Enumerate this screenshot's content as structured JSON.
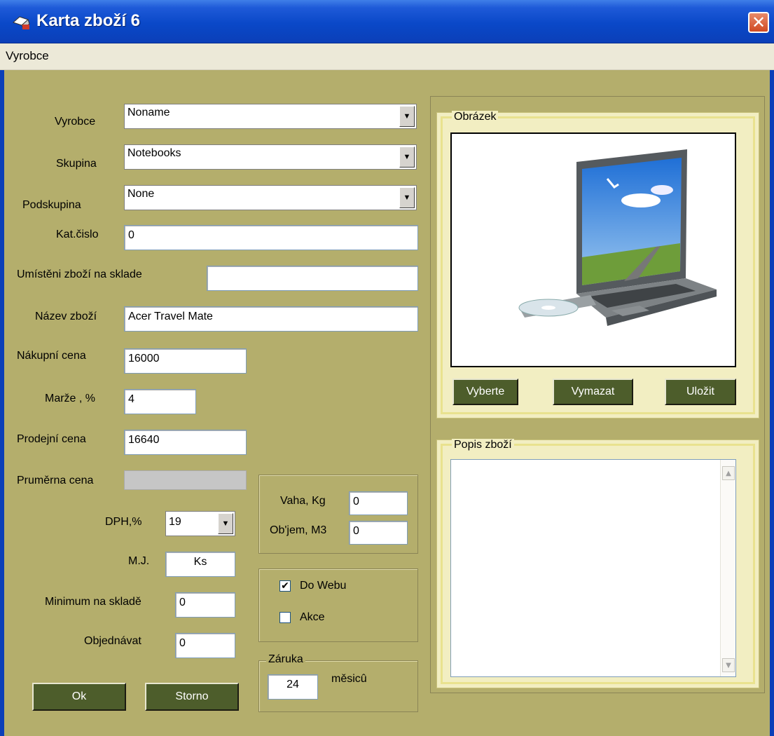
{
  "window": {
    "title": "Karta zboží 6",
    "close_glyph": "✕"
  },
  "menu": {
    "items": [
      "Vyrobce"
    ]
  },
  "form": {
    "vyrobce": {
      "label": "Vyrobce",
      "value": "Noname"
    },
    "skupina": {
      "label": "Skupina",
      "value": "Notebooks"
    },
    "podskupina": {
      "label": "Podskupina",
      "value": "None"
    },
    "kat_cislo": {
      "label": "Kat.čislo",
      "value": "0"
    },
    "umisteni": {
      "label": "Umístěni zboží na sklade",
      "value": ""
    },
    "nazev": {
      "label": "Název zboží",
      "value": "Acer Travel Mate"
    },
    "nakupni_cena": {
      "label": "Nákupní cena",
      "value": "16000"
    },
    "marze": {
      "label": "Marže , %",
      "value": "4"
    },
    "prodejni_cena": {
      "label": "Prodejní cena",
      "value": "16640"
    },
    "prumerna_cena": {
      "label": "Pruměrna cena",
      "value": ""
    },
    "dph": {
      "label": "DPH,%",
      "value": "19"
    },
    "mj": {
      "label": "M.J.",
      "value": "Ks"
    },
    "minimum": {
      "label": "Minimum na skladě",
      "value": "0"
    },
    "objednavat": {
      "label": "Objednávat",
      "value": "0"
    }
  },
  "weight": {
    "vaha": {
      "label": "Vaha, Kg",
      "value": "0"
    },
    "objem": {
      "label": "Ob'jem, M3",
      "value": "0"
    }
  },
  "flags": {
    "do_webu": {
      "label": "Do Webu",
      "checked": true
    },
    "akce": {
      "label": "Akce",
      "checked": false
    }
  },
  "zaruka": {
    "legend": "Záruka",
    "value": "24",
    "unit": "měsicû"
  },
  "buttons": {
    "ok": "Ok",
    "storno": "Storno",
    "vyberte": "Vyberte",
    "vymazat": "Vymazat",
    "ulozit": "Uložit"
  },
  "picture": {
    "legend": "Obrázek",
    "alt": "laptop-image"
  },
  "description": {
    "legend": "Popis zboží",
    "value": ""
  },
  "colors": {
    "window_bg": "#b4ae6c",
    "button_bg": "#4d5d2b",
    "titlebar": "#0b46c8"
  }
}
